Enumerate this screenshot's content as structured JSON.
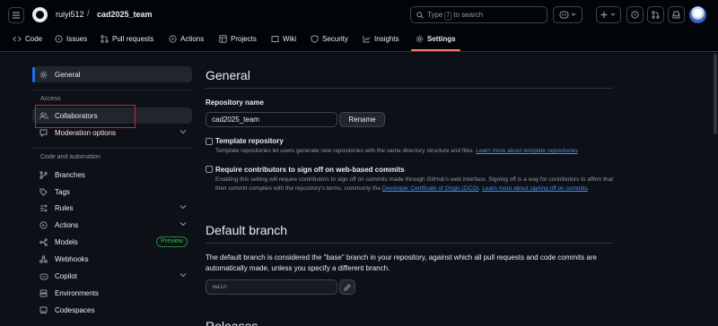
{
  "header": {
    "owner": "ruiyi512",
    "separator": "/",
    "repo": "cad2025_team",
    "search_type": "Type",
    "search_key": "/",
    "search_suffix": "to search"
  },
  "tabs": [
    {
      "label": "Code",
      "icon": "code-icon"
    },
    {
      "label": "Issues",
      "icon": "issue-opened-icon"
    },
    {
      "label": "Pull requests",
      "icon": "git-pull-request-icon"
    },
    {
      "label": "Actions",
      "icon": "play-icon"
    },
    {
      "label": "Projects",
      "icon": "table-icon"
    },
    {
      "label": "Wiki",
      "icon": "book-icon"
    },
    {
      "label": "Security",
      "icon": "shield-icon"
    },
    {
      "label": "Insights",
      "icon": "graph-icon"
    },
    {
      "label": "Settings",
      "icon": "gear-icon",
      "active": true
    }
  ],
  "sidebar": {
    "general": "General",
    "access_heading": "Access",
    "collaborators": "Collaborators",
    "moderation": "Moderation options",
    "code_heading": "Code and automation",
    "items": [
      "Branches",
      "Tags",
      "Rules",
      "Actions",
      "Models",
      "Webhooks",
      "Copilot",
      "Environments",
      "Codespaces"
    ],
    "models_badge": "Preview"
  },
  "main": {
    "title": "General",
    "repo_name_label": "Repository name",
    "repo_name_value": "cad2025_team",
    "rename_label": "Rename",
    "template_title": "Template repository",
    "template_desc": "Template repositories let users generate new repositories with the same directory structure and files.",
    "template_link": "Learn more about template repositories",
    "signoff_title": "Require contributors to sign off on web-based commits",
    "signoff_desc": "Enabling this setting will require contributors to sign off on commits made through GitHub's web interface. Signing off is a way for contributors to affirm that their commit complies with the repository's terms, commonly the",
    "signoff_link1": "Developer Certificate of Origin (DCO)",
    "signoff_link2": "Learn more about signing off on commits",
    "default_branch_title": "Default branch",
    "default_branch_desc": "The default branch is considered the \"base\" branch in your repository, against which all pull requests and code commits are automatically made, unless you specify a different branch.",
    "default_branch_value": "main",
    "next_section_partial": "Releases"
  },
  "colors": {
    "accent": "#1f6feb",
    "tab_underline": "#f78166",
    "highlight_box": "#d1242f",
    "link": "#4493f8"
  }
}
